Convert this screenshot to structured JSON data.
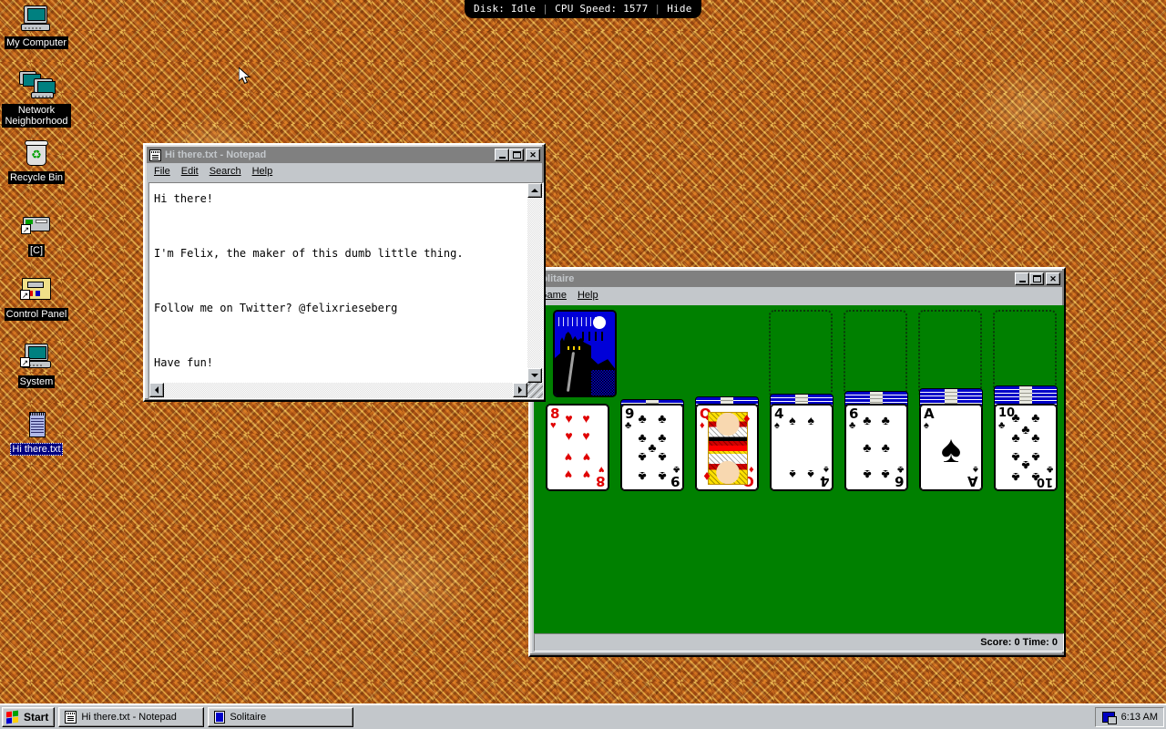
{
  "topbar": {
    "disk_label": "Disk: Idle",
    "cpu_label": "CPU Speed: 1577",
    "hide_label": "Hide",
    "sep": "|"
  },
  "desktop": {
    "icons": [
      {
        "name": "my-computer",
        "label": "My Computer",
        "selected": false
      },
      {
        "name": "network-neighborhood",
        "label": "Network Neighborhood",
        "selected": false
      },
      {
        "name": "recycle-bin",
        "label": "Recycle Bin",
        "selected": false
      },
      {
        "name": "drive-c",
        "label": "[C]",
        "selected": false
      },
      {
        "name": "control-panel",
        "label": "Control Panel",
        "selected": false
      },
      {
        "name": "system",
        "label": "System",
        "selected": false
      },
      {
        "name": "hi-there-txt",
        "label": "Hi there.txt",
        "selected": true
      }
    ]
  },
  "notepad": {
    "title": "Hi there.txt - Notepad",
    "active": false,
    "menu": [
      {
        "label": "File",
        "accel": "F"
      },
      {
        "label": "Edit",
        "accel": "E"
      },
      {
        "label": "Search",
        "accel": "S"
      },
      {
        "label": "Help",
        "accel": "H"
      }
    ],
    "buttons": {
      "minimize": "Minimize",
      "maximize": "Maximize",
      "close": "Close"
    },
    "text": "Hi there!\n\nI'm Felix, the maker of this dumb little thing.\n\nFollow me on Twitter? @felixrieseberg\n\nHave fun!"
  },
  "solitaire": {
    "title": "Solitaire",
    "active": false,
    "menu": [
      {
        "label": "Game",
        "accel": "G"
      },
      {
        "label": "Help",
        "accel": "H"
      }
    ],
    "buttons": {
      "minimize": "Minimize",
      "maximize": "Maximize",
      "close": "Close"
    },
    "status": "Score: 0 Time: 0",
    "score": 0,
    "time": 0,
    "felt_color": "#008000",
    "stock": {
      "name": "stock-pile",
      "state": "face-down",
      "back": "castle"
    },
    "waste": {
      "name": "waste-pile",
      "state": "empty"
    },
    "foundations": [
      {
        "name": "foundation-1",
        "state": "empty"
      },
      {
        "name": "foundation-2",
        "state": "empty"
      },
      {
        "name": "foundation-3",
        "state": "empty"
      },
      {
        "name": "foundation-4",
        "state": "empty"
      }
    ],
    "tableau": [
      {
        "name": "tableau-1",
        "facedown": 0,
        "rank": "8",
        "suit": "hearts",
        "color": "red",
        "symbol": "♥"
      },
      {
        "name": "tableau-2",
        "facedown": 1,
        "rank": "9",
        "suit": "clubs",
        "color": "black",
        "symbol": "♣"
      },
      {
        "name": "tableau-3",
        "facedown": 2,
        "rank": "Q",
        "suit": "diamonds",
        "color": "red",
        "symbol": "♦"
      },
      {
        "name": "tableau-4",
        "facedown": 3,
        "rank": "4",
        "suit": "spades",
        "color": "black",
        "symbol": "♠"
      },
      {
        "name": "tableau-5",
        "facedown": 4,
        "rank": "6",
        "suit": "clubs",
        "color": "black",
        "symbol": "♣"
      },
      {
        "name": "tableau-6",
        "facedown": 5,
        "rank": "A",
        "suit": "spades",
        "color": "black",
        "symbol": "♠"
      },
      {
        "name": "tableau-7",
        "facedown": 6,
        "rank": "10",
        "suit": "clubs",
        "color": "black",
        "symbol": "♣"
      }
    ]
  },
  "taskbar": {
    "start_label": "Start",
    "items": [
      {
        "name": "taskbar-item-notepad",
        "label": "Hi there.txt - Notepad",
        "icon": "notepad-icon"
      },
      {
        "name": "taskbar-item-solitaire",
        "label": "Solitaire",
        "icon": "solitaire-icon"
      }
    ],
    "clock": "6:13 AM"
  }
}
